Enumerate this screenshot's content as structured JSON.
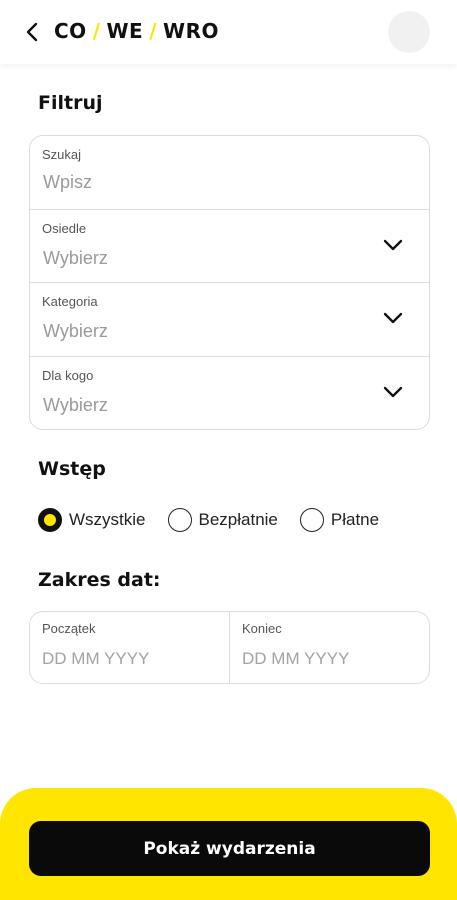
{
  "header": {
    "back_icon": "chevron-left-icon",
    "logo": {
      "part1": "CO",
      "part2": "WE",
      "part3": "WRO",
      "slash": "/",
      "slash_color": "#FFE500"
    }
  },
  "filter": {
    "title": "Filtruj",
    "search": {
      "label": "Szukaj",
      "placeholder": "Wpisz"
    },
    "neighborhood": {
      "label": "Osiedle",
      "value": "Wybierz"
    },
    "category": {
      "label": "Kategoria",
      "value": "Wybierz"
    },
    "audience": {
      "label": "Dla kogo",
      "value": "Wybierz"
    }
  },
  "admission": {
    "title": "Wstęp",
    "options": [
      {
        "label": "Wszystkie",
        "selected": true
      },
      {
        "label": "Bezpłatnie",
        "selected": false
      },
      {
        "label": "Płatne",
        "selected": false
      }
    ]
  },
  "date_range": {
    "title": "Zakres dat:",
    "start": {
      "label": "Początek",
      "placeholder": "DD MM YYYY"
    },
    "end": {
      "label": "Koniec",
      "placeholder": "DD MM YYYY"
    }
  },
  "cta": {
    "label": "Pokaż wydarzenia"
  },
  "colors": {
    "accent": "#FFE500",
    "button": "#0a0a0a"
  }
}
